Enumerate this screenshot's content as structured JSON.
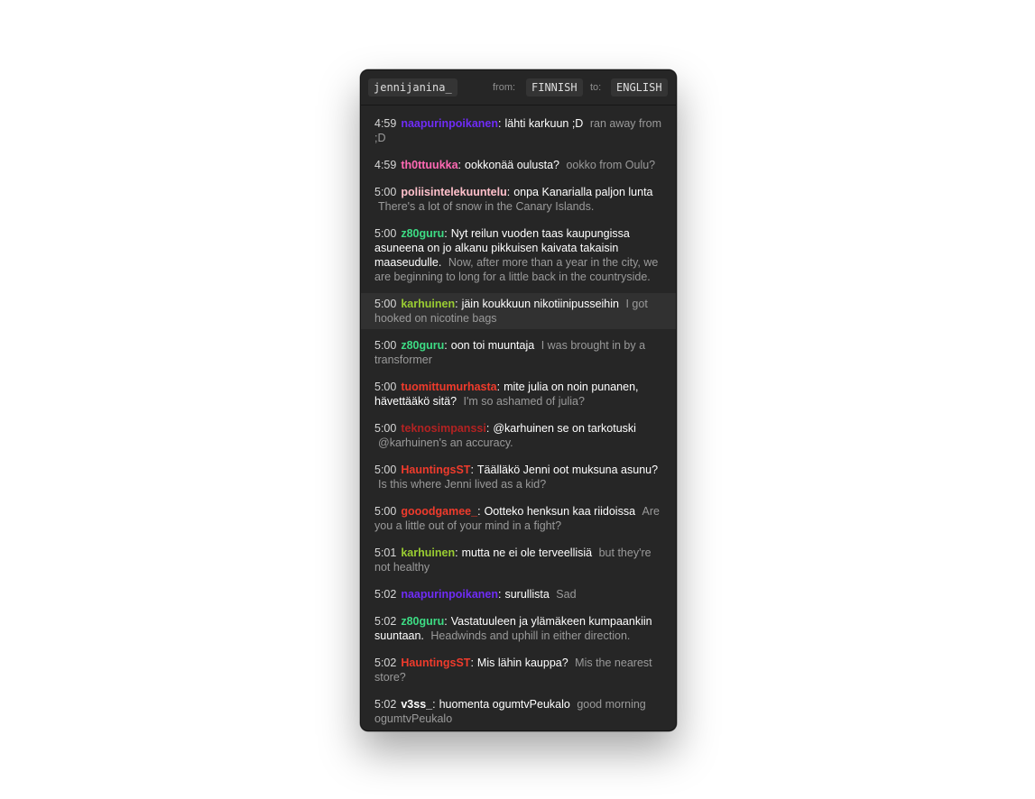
{
  "header": {
    "channel": "jennijanina_",
    "from_label": "from:",
    "from_lang": "FINNISH",
    "to_label": "to:",
    "to_lang": "ENGLISH"
  },
  "messages": [
    {
      "time": "4:59",
      "user": "naapurinpoikanen",
      "color": "#6f2cf6",
      "original": "lähti karkuun ;D",
      "translation": "ran away from ;D",
      "highlight": false
    },
    {
      "time": "4:59",
      "user": "th0ttuukka",
      "color": "#ff69b4",
      "original": "ookkonää oulusta?",
      "translation": "ookko from Oulu?",
      "highlight": false
    },
    {
      "time": "5:00",
      "user": "poliisintelekuuntelu",
      "color": "#ffc0cb",
      "original": "onpa Kanarialla paljon lunta",
      "translation": "There's a lot of snow in the Canary Islands.",
      "highlight": false
    },
    {
      "time": "5:00",
      "user": "z80guru",
      "color": "#3ddc84",
      "original": "Nyt reilun vuoden taas kaupungissa asuneena on jo alkanu pikkuisen kaivata takaisin maaseudulle.",
      "translation": "Now, after more than a year in the city, we are beginning to long for a little back in the countryside.",
      "highlight": false
    },
    {
      "time": "5:00",
      "user": "karhuinen",
      "color": "#9acd32",
      "original": "jäin koukkuun nikotiinipusseihin",
      "translation": "I got hooked on nicotine bags",
      "highlight": true
    },
    {
      "time": "5:00",
      "user": "z80guru",
      "color": "#3ddc84",
      "original": "oon toi muuntaja",
      "translation": "I was brought in by a transformer",
      "highlight": false
    },
    {
      "time": "5:00",
      "user": "tuomittumurhasta",
      "color": "#ef3b2c",
      "original": "mite julia on noin punanen, hävettääkö sitä?",
      "translation": "I'm so ashamed of julia?",
      "highlight": false
    },
    {
      "time": "5:00",
      "user": "teknosimpanssi",
      "color": "#b22222",
      "original": "@karhuinen se on tarkotuski",
      "translation": "@karhuinen's an accuracy.",
      "highlight": false
    },
    {
      "time": "5:00",
      "user": "HauntingsST",
      "color": "#ef3b2c",
      "original": "Täälläkö Jenni oot muksuna asunu?",
      "translation": "Is this where Jenni lived as a kid?",
      "highlight": false
    },
    {
      "time": "5:00",
      "user": "gooodgamee_",
      "color": "#ef3b2c",
      "original": "Ootteko henksun kaa riidoissa",
      "translation": "Are you a little out of your mind in a fight?",
      "highlight": false
    },
    {
      "time": "5:01",
      "user": "karhuinen",
      "color": "#9acd32",
      "original": "mutta ne ei ole terveellisiä",
      "translation": "but they're not healthy",
      "highlight": false
    },
    {
      "time": "5:02",
      "user": "naapurinpoikanen",
      "color": "#6f2cf6",
      "original": "surullista",
      "translation": "Sad",
      "highlight": false
    },
    {
      "time": "5:02",
      "user": "z80guru",
      "color": "#3ddc84",
      "original": "Vastatuuleen ja ylämäkeen kumpaankiin suuntaan.",
      "translation": "Headwinds and uphill in either direction.",
      "highlight": false
    },
    {
      "time": "5:02",
      "user": "HauntingsST",
      "color": "#ef3b2c",
      "original": "Mis lähin kauppa?",
      "translation": "Mis the nearest store?",
      "highlight": false
    },
    {
      "time": "5:02",
      "user": "v3ss_",
      "color": "#ffffff",
      "original": "huomenta ogumtvPeukalo",
      "translation": "good morning ogumtvPeukalo",
      "highlight": false
    }
  ]
}
